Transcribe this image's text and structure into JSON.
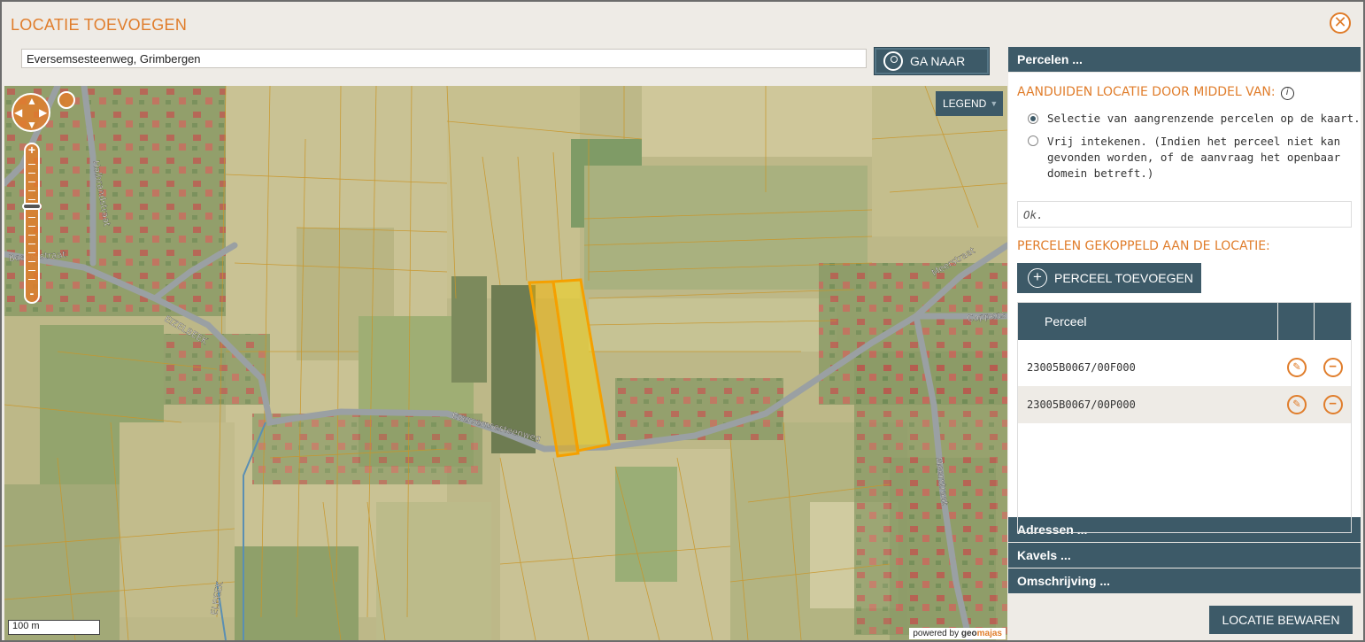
{
  "dialog": {
    "title": "LOCATIE TOEVOEGEN",
    "close_symbol": "✕"
  },
  "search": {
    "value": "Eversemsesteenweg, Grimbergen",
    "button_label": "GA NAAR"
  },
  "map": {
    "legend_label": "LEGEND",
    "scale_label": "100 m",
    "powered_prefix": "powered by",
    "powered_brand_a": "geo",
    "powered_brand_b": "majas",
    "street_labels": [
      "Halbrandstraat",
      "Beemdstraat",
      "EIZELBEEK",
      "Eversemsesteenweg",
      "Meerstraat",
      "Meerstraat",
      "Coppens",
      "ELBEEK"
    ],
    "highlight_color": "#f5b400"
  },
  "panel": {
    "percelen_header": "Percelen ...",
    "aanduiden_title": "AANDUIDEN LOCATIE DOOR MIDDEL VAN:",
    "info_symbol": "i",
    "option_selectie": "Selectie van aangrenzende percelen op de kaart.",
    "option_vrij": "Vrij intekenen. (Indien het perceel niet kan gevonden worden, of de aanvraag het openbaar domein betreft.)",
    "ok_text": "Ok.",
    "gekoppeld_title": "PERCELEN GEKOPPELD AAN DE LOCATIE:",
    "add_button": "PERCEEL TOEVOEGEN",
    "table": {
      "header": "Perceel",
      "rows": [
        "23005B0067/00F000",
        "23005B0067/00P000"
      ]
    },
    "adressen_header": "Adressen ...",
    "kavels_header": "Kavels ...",
    "omschrijving_header": "Omschrijving ..."
  },
  "save_button": "LOCATIE BEWAREN",
  "colors": {
    "accent": "#e07d2b",
    "header_bg": "#3d5a68",
    "dialog_bg": "#eeebe6"
  }
}
